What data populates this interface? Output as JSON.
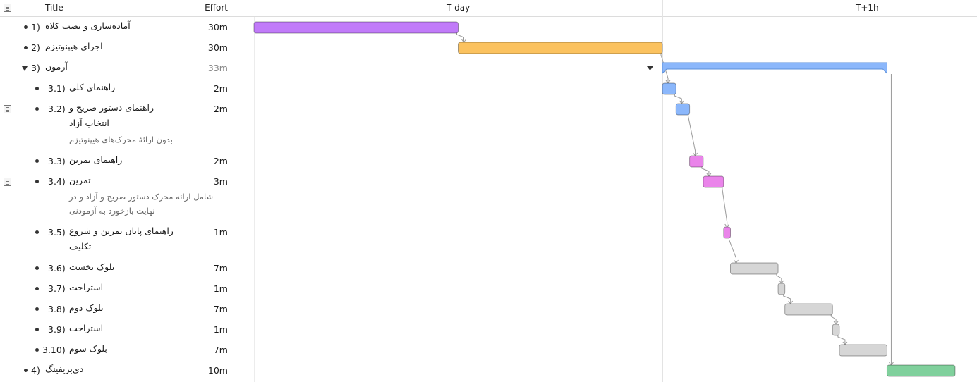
{
  "header": {
    "title_label": "Title",
    "effort_label": "Effort",
    "timeline_labels": [
      "T day",
      "T+1h"
    ]
  },
  "colors": {
    "purple": "#c17bf9",
    "orange": "#fbc25f",
    "blue": "#8bb7fb",
    "pink": "#ea84ea",
    "gray": "#d6d6d6",
    "green": "#80d09c",
    "arrow": "#9a9a9a"
  },
  "tasks": [
    {
      "id": "t1",
      "number": "1)",
      "title": "آماده‌سازی و نصب کلاه",
      "effort": "30m",
      "note": "",
      "start_min": 0,
      "duration_min": 30,
      "color": "purple",
      "type": "task",
      "level": 0,
      "has_note": false
    },
    {
      "id": "t2",
      "number": "2)",
      "title": "اجرای هیپنوتیزم",
      "effort": "30m",
      "note": "",
      "start_min": 30,
      "duration_min": 30,
      "color": "orange",
      "type": "task",
      "level": 0,
      "has_note": false
    },
    {
      "id": "t3",
      "number": "3)",
      "title": "آزمون",
      "effort": "33m",
      "note": "",
      "start_min": 60,
      "duration_min": 33,
      "color": "blue",
      "type": "group",
      "level": 0,
      "has_note": false
    },
    {
      "id": "t31",
      "number": "3.1)",
      "title": "راهنمای کلی",
      "effort": "2m",
      "note": "",
      "start_min": 60,
      "duration_min": 2,
      "color": "blue",
      "type": "task",
      "level": 1,
      "has_note": false
    },
    {
      "id": "t32",
      "number": "3.2)",
      "title": "راهنمای دستور صریح و\nانتخاب آزاد",
      "effort": "2m",
      "note": "بدون ارائهٔ محرک‌های هیپنوتیزم",
      "start_min": 62,
      "duration_min": 2,
      "color": "blue",
      "type": "task",
      "level": 1,
      "has_note": true
    },
    {
      "id": "t33",
      "number": "3.3)",
      "title": "راهنمای تمرین",
      "effort": "2m",
      "note": "",
      "start_min": 64,
      "duration_min": 2,
      "color": "pink",
      "type": "task",
      "level": 1,
      "has_note": false
    },
    {
      "id": "t34",
      "number": "3.4)",
      "title": "تمرین",
      "effort": "3m",
      "note": "شامل ارائه محرک دستور صریح و آزاد و در\nنهایت بازخورد به آزمودنی",
      "start_min": 66,
      "duration_min": 3,
      "color": "pink",
      "type": "task",
      "level": 1,
      "has_note": true
    },
    {
      "id": "t35",
      "number": "3.5)",
      "title": "راهنمای پایان تمرین و شروع\nتکلیف",
      "effort": "1m",
      "note": "",
      "start_min": 69,
      "duration_min": 1,
      "color": "pink",
      "type": "task",
      "level": 1,
      "has_note": false
    },
    {
      "id": "t36",
      "number": "3.6)",
      "title": "بلوک نخست",
      "effort": "7m",
      "note": "",
      "start_min": 70,
      "duration_min": 7,
      "color": "gray",
      "type": "task",
      "level": 1,
      "has_note": false
    },
    {
      "id": "t37",
      "number": "3.7)",
      "title": "استراحت",
      "effort": "1m",
      "note": "",
      "start_min": 77,
      "duration_min": 1,
      "color": "gray",
      "type": "task",
      "level": 1,
      "has_note": false
    },
    {
      "id": "t38",
      "number": "3.8)",
      "title": "بلوک دوم",
      "effort": "7m",
      "note": "",
      "start_min": 78,
      "duration_min": 7,
      "color": "gray",
      "type": "task",
      "level": 1,
      "has_note": false
    },
    {
      "id": "t39",
      "number": "3.9)",
      "title": "استراحت",
      "effort": "1m",
      "note": "",
      "start_min": 85,
      "duration_min": 1,
      "color": "gray",
      "type": "task",
      "level": 1,
      "has_note": false
    },
    {
      "id": "t310",
      "number": "3.10)",
      "title": "بلوک سوم",
      "effort": "7m",
      "note": "",
      "start_min": 86,
      "duration_min": 7,
      "color": "gray",
      "type": "task",
      "level": 1,
      "has_note": false
    },
    {
      "id": "t4",
      "number": "4)",
      "title": "دی‌بریفینگ",
      "effort": "10m",
      "note": "",
      "start_min": 93,
      "duration_min": 10,
      "color": "green",
      "type": "task",
      "level": 0,
      "has_note": false
    }
  ]
}
